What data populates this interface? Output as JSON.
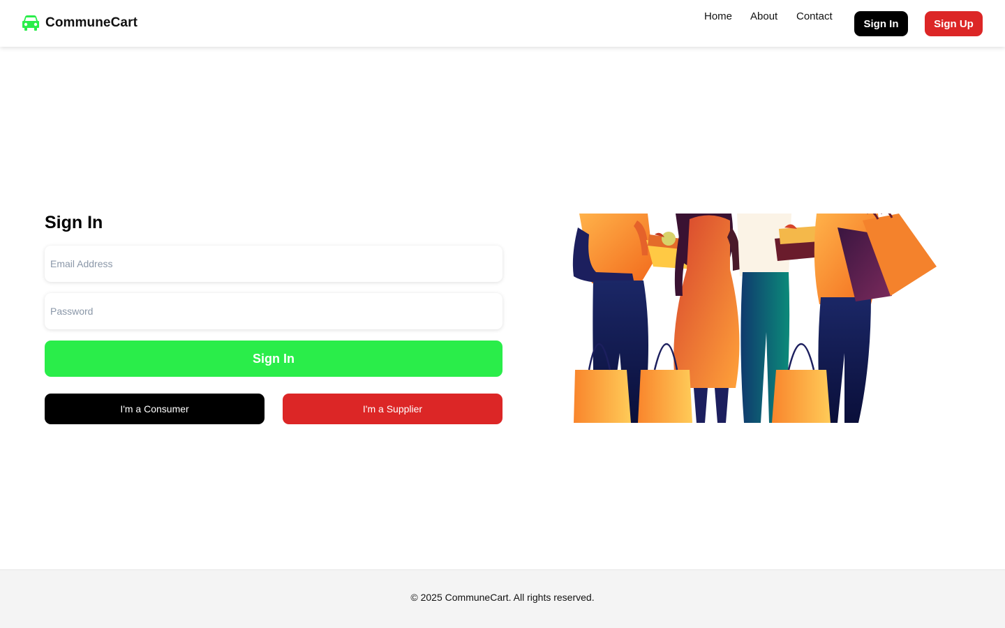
{
  "header": {
    "brand_name": "CommuneCart",
    "brand_icon": "car-icon",
    "brand_color": "#2aed4a",
    "nav": [
      {
        "label": "Home"
      },
      {
        "label": "About"
      },
      {
        "label": "Contact"
      }
    ],
    "sign_in_label": "Sign In",
    "sign_up_label": "Sign Up"
  },
  "form": {
    "title": "Sign In",
    "email_placeholder": "Email Address",
    "email_value": "",
    "password_placeholder": "Password",
    "password_value": "",
    "submit_label": "Sign In",
    "consumer_label": "I'm a Consumer",
    "supplier_label": "I'm a Supplier"
  },
  "illustration": {
    "subject": "shoppers-with-bags-illustration"
  },
  "colors": {
    "accent_green": "#2aed4a",
    "accent_red": "#dc2626",
    "black": "#000000",
    "footer_bg": "#f4f4f4"
  },
  "footer": {
    "copyright": "© 2025 CommuneCart. All rights reserved."
  }
}
